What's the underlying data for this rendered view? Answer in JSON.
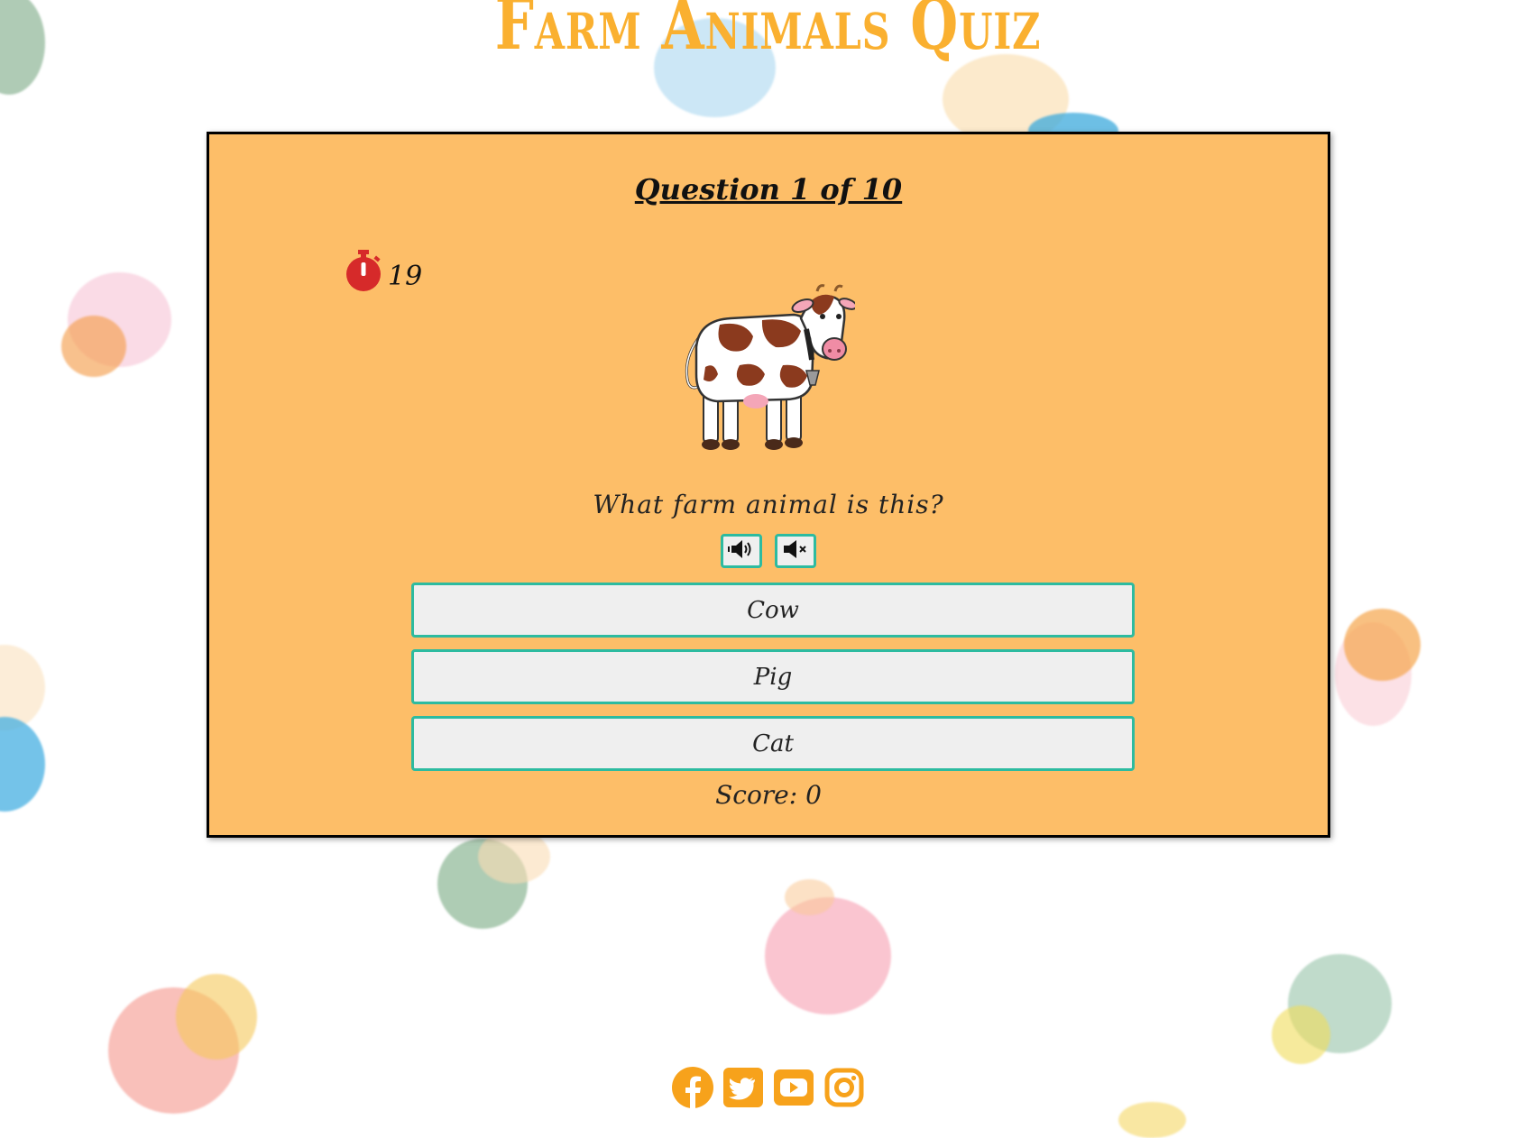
{
  "page": {
    "title": "Farm Animals Quiz"
  },
  "quiz": {
    "question_counter": "Question 1 of 10",
    "timer_value": "19",
    "question_text": "What farm animal is this?",
    "image_icon": "cow-image",
    "sound_on_icon": "volume-up-icon",
    "sound_off_icon": "volume-mute-icon",
    "answers": [
      "Cow",
      "Pig",
      "Cat"
    ],
    "score_text": "Score: 0"
  },
  "footer": {
    "social_icons": [
      "facebook-icon",
      "twitter-icon",
      "youtube-icon",
      "instagram-icon"
    ]
  },
  "colors": {
    "title": "#fab030",
    "card_background": "#fdbe68",
    "button_border": "#2dbba0",
    "button_background": "#efefef",
    "timer_icon": "#d62a2a",
    "social_icon": "#f7a21b"
  }
}
